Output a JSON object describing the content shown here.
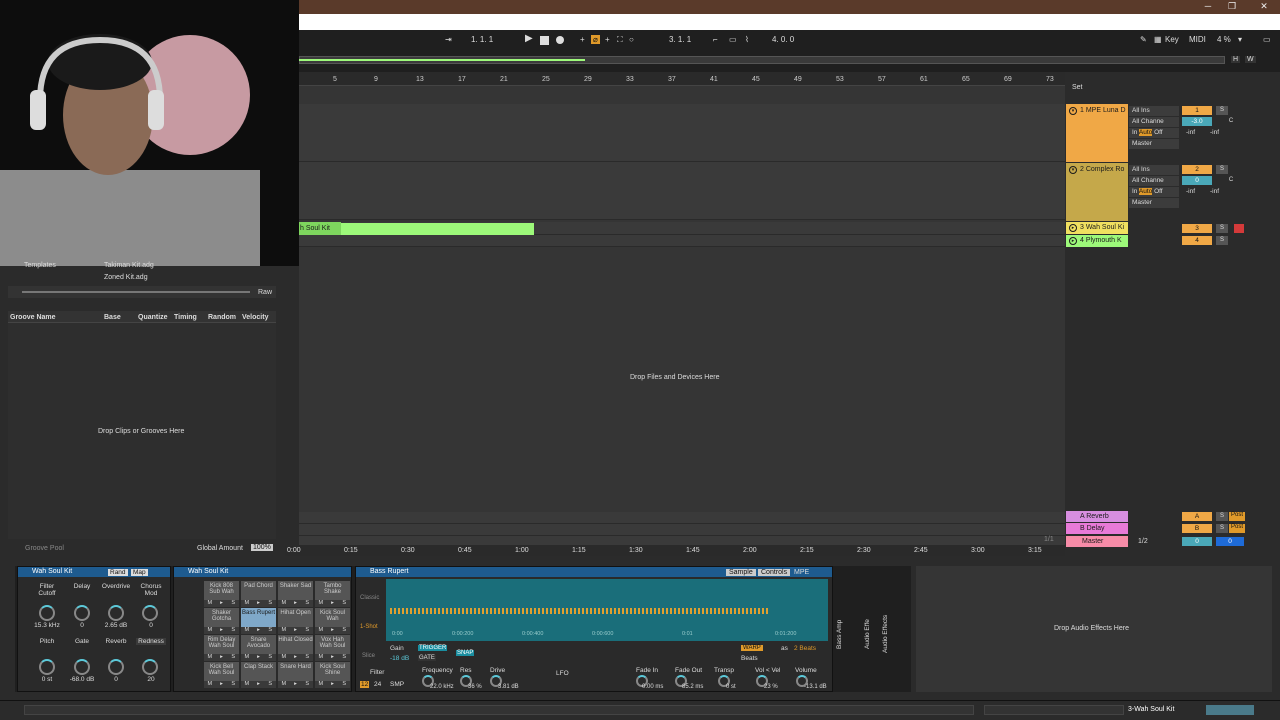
{
  "window": {
    "minimize": "─",
    "restore": "❐",
    "close": "✕"
  },
  "transport": {
    "position": "1.  1.  1",
    "loop_start": "3.  1.  1",
    "loop_length": "4.  0.  0",
    "key": "Key",
    "midi": "MIDI",
    "cpu": "4 %"
  },
  "ruler": [
    "5",
    "9",
    "13",
    "17",
    "21",
    "25",
    "29",
    "33",
    "37",
    "41",
    "45",
    "49",
    "53",
    "57",
    "61",
    "65",
    "69",
    "73"
  ],
  "set_label": "Set",
  "tracks": [
    {
      "name": "1 MPE Luna D",
      "color": "#f0a846",
      "input": "All Ins",
      "channel": "All Channe",
      "monitor_in": "In",
      "monitor_auto": "Auto",
      "monitor_off": "Off",
      "output": "Master",
      "num": "1",
      "s": "S",
      "vol": "-3.0",
      "pan": "C",
      "peak1": "-inf",
      "peak2": "-inf"
    },
    {
      "name": "2 Complex Ro",
      "color": "#c5a84a",
      "input": "All Ins",
      "channel": "All Channe",
      "monitor_in": "In",
      "monitor_auto": "Auto",
      "monitor_off": "Off",
      "output": "Master",
      "num": "2",
      "s": "S",
      "vol": "0",
      "pan": "C",
      "peak1": "-inf",
      "peak2": "-inf"
    },
    {
      "name": "3 Wah Soul Ki",
      "color": "#f0e060",
      "num": "3",
      "s": "S"
    },
    {
      "name": "4 Plymouth K",
      "color": "#9df97a",
      "num": "4",
      "s": "S"
    }
  ],
  "returns": [
    {
      "name": "A Reverb",
      "color": "#d78ee0",
      "num": "A",
      "s": "S",
      "post": "Post"
    },
    {
      "name": "B Delay",
      "color": "#e87ad8",
      "num": "B",
      "s": "S",
      "post": "Post"
    },
    {
      "name": "Master",
      "color": "#f78ca8",
      "out": "1/2",
      "num": "0",
      "vol": "0"
    }
  ],
  "clip": {
    "label": "h Soul Kit"
  },
  "arrange": {
    "drop_hint": "Drop Files and Devices Here",
    "loop_marker": "1/1"
  },
  "timeline": [
    "0:00",
    "0:15",
    "0:30",
    "0:45",
    "1:00",
    "1:15",
    "1:30",
    "1:45",
    "2:00",
    "2:15",
    "2:30",
    "2:45",
    "3:00",
    "3:15"
  ],
  "browser": {
    "templates": "Templates",
    "file1": "Takiman Kit.adg",
    "file2": "Zoned Kit.adg",
    "raw": "Raw"
  },
  "groove": {
    "headers": [
      "Groove Name",
      "Base",
      "Quantize",
      "Timing",
      "Random",
      "Velocity"
    ],
    "drop_hint": "Drop Clips or Grooves Here",
    "pool": "Groove Pool",
    "global": "Global Amount",
    "global_val": "100%"
  },
  "rack": {
    "title": "Wah Soul Kit",
    "rand": "Rand",
    "map": "Map",
    "macros": [
      {
        "label": "Filter Cutoff",
        "value": "15.3 kHz"
      },
      {
        "label": "Delay",
        "value": "0"
      },
      {
        "label": "Overdrive",
        "value": "2.65 dB"
      },
      {
        "label": "Chorus Mod",
        "value": "0"
      },
      {
        "label": "Pitch",
        "value": "0 st"
      },
      {
        "label": "Gate",
        "value": "-68.0 dB"
      },
      {
        "label": "Reverb",
        "value": "0"
      },
      {
        "label": "Redness",
        "value": "20"
      }
    ]
  },
  "drum": {
    "title": "Wah Soul Kit",
    "pads": [
      "Kick 808 Sub Wah",
      "Pad Chord",
      "Shaker Sad",
      "Tambo Shake",
      "Shaker Gotcha",
      "Bass Rupert",
      "Hihat Open",
      "Kick Soul Wah",
      "Rim Delay Wah Soul",
      "Snare Avocado",
      "Hihat Closed",
      "Vox Hah Wah Soul",
      "Kick Bell Wah Soul",
      "Clap Stack",
      "Snare Hard",
      "Kick Soul Shine"
    ]
  },
  "sampler": {
    "title": "Bass Rupert",
    "tab_sample": "Sample",
    "tab_controls": "Controls",
    "tab_mpe": "MPE",
    "classic": "Classic",
    "oneshot": "1-Shot",
    "slice": "Slice",
    "gain": "Gain",
    "gain_val": "-18 dB",
    "trigger": "TRIGGER",
    "gate": "GATE",
    "snap": "SNAP",
    "warp": "WARP",
    "as": "as",
    "beats_val": "2 Beats",
    "beats": "Beats",
    "times": [
      "0:00",
      "0:00:200",
      "0:00:400",
      "0:00:600",
      "0:01",
      "0:01:200"
    ],
    "filter": "Filter",
    "filter_num": "12",
    "filter_type": "24",
    "smp": "SMP",
    "freq": "Frequency",
    "freq_val": "22.0 kHz",
    "res": "Res",
    "res_val": "36 %",
    "drive": "Drive",
    "drive_val": "3.81 dB",
    "lfo": "LFO",
    "fadein": "Fade In",
    "fadein_val": "0.00 ms",
    "fadeout": "Fade Out",
    "fadeout_val": "85.2 ms",
    "transp": "Transp",
    "transp_val": "0 st",
    "vel": "Vol < Vel",
    "vel_val": "23 %",
    "volume": "Volume",
    "volume_val": "-13.1 dB"
  },
  "side_labels": {
    "bass_amp": "Bass Amp",
    "audio_fx1": "Audio Effe",
    "audio_fx2": "Audio Effects"
  },
  "drop_fx": "Drop Audio Effects Here",
  "status": {
    "track": "3-Wah Soul Kit"
  }
}
